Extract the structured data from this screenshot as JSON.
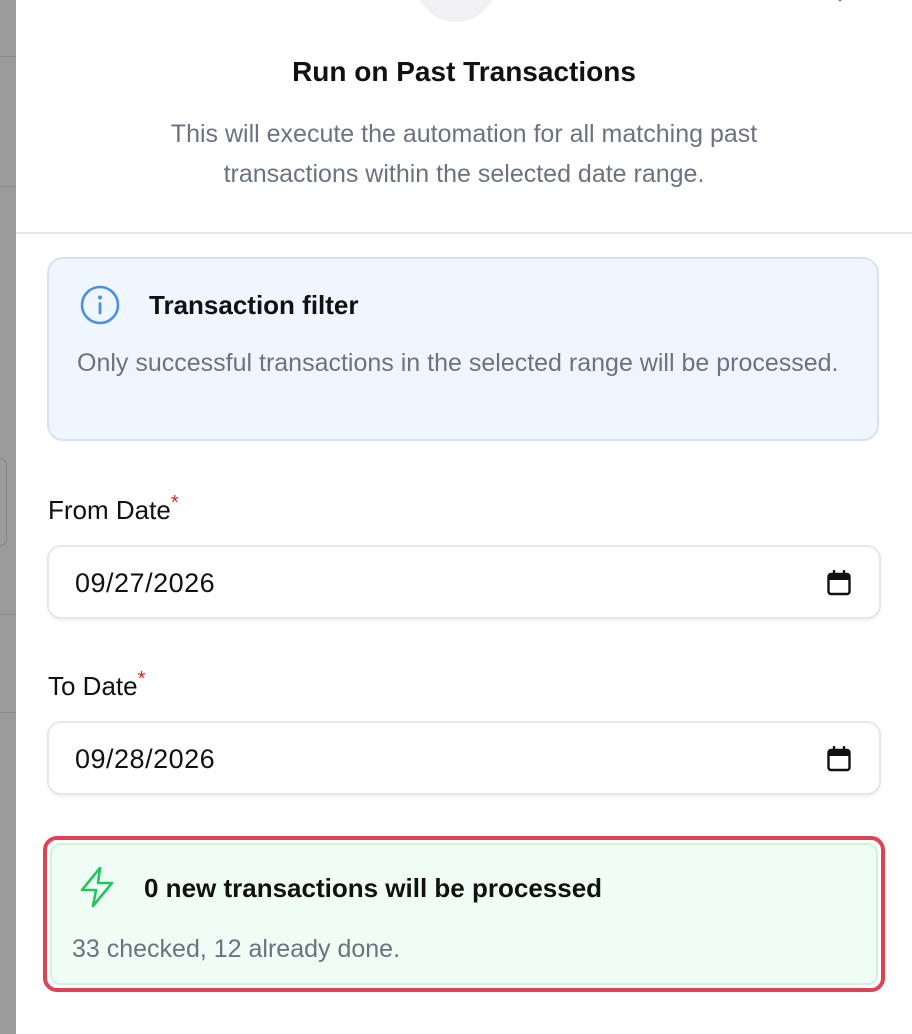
{
  "dialog": {
    "title": "Run on Past Transactions",
    "subtitle": "This will execute the automation for all matching past transactions within the selected date range."
  },
  "info_box": {
    "icon": "info-icon",
    "title": "Transaction filter",
    "text": "Only successful transactions in the selected range will be processed.",
    "color": "#4a90e2"
  },
  "form": {
    "from_date": {
      "label": "From Date",
      "required_mark": "*",
      "value": "09/27/2026",
      "icon": "calendar-icon"
    },
    "to_date": {
      "label": "To Date",
      "required_mark": "*",
      "value": "09/28/2026",
      "icon": "calendar-icon"
    }
  },
  "result": {
    "icon": "lightning-icon",
    "title": "0 new transactions will be processed",
    "text": "33 checked, 12 already done.",
    "icon_color": "#22c55e",
    "highlight_color": "#dc4451"
  }
}
